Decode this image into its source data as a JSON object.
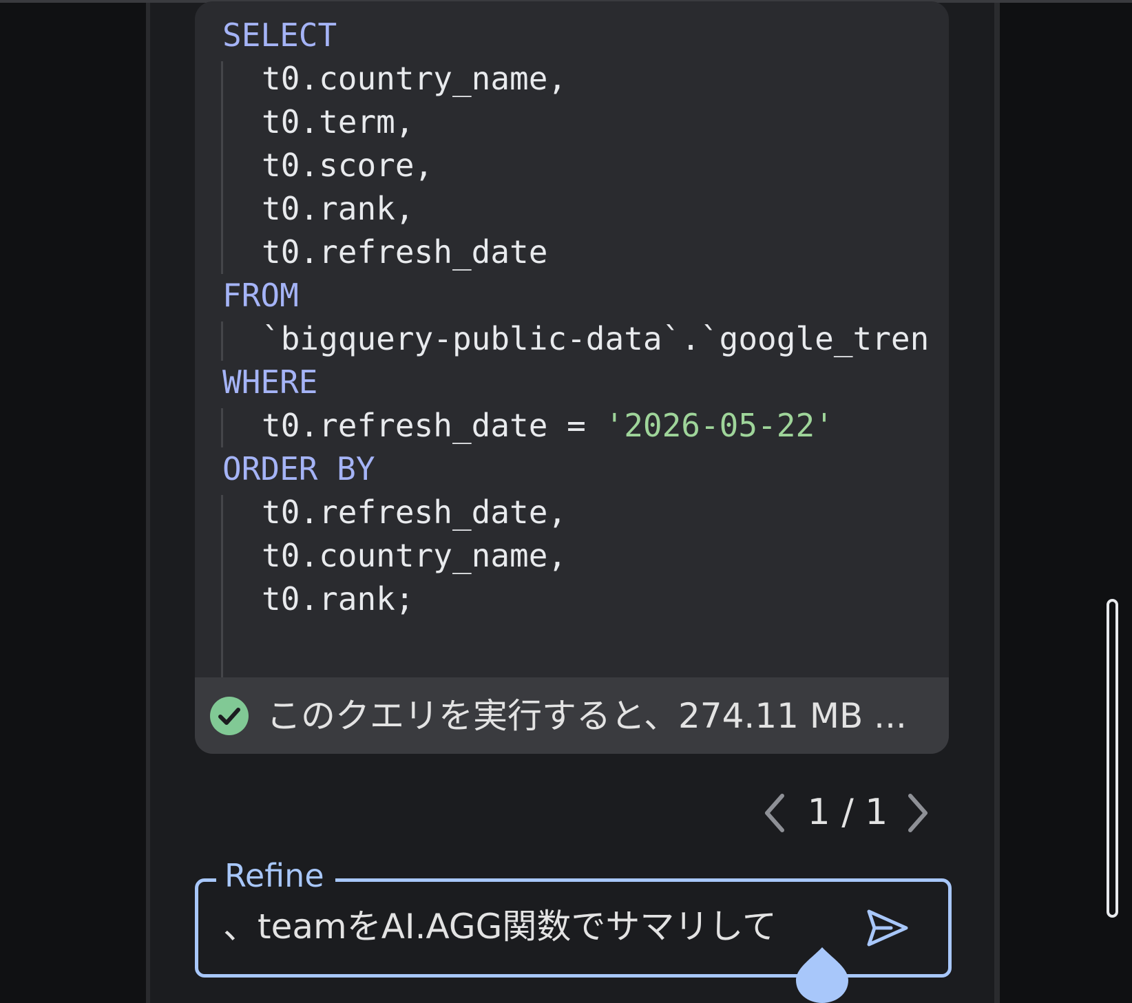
{
  "code": {
    "lines": [
      {
        "tokens": [
          {
            "text": "SELECT",
            "kind": "kw"
          }
        ],
        "indent": false
      },
      {
        "tokens": [
          {
            "text": "t0.country_name,",
            "kind": "plain"
          }
        ],
        "indent": true
      },
      {
        "tokens": [
          {
            "text": "t0.term,",
            "kind": "plain"
          }
        ],
        "indent": true
      },
      {
        "tokens": [
          {
            "text": "t0.score,",
            "kind": "plain"
          }
        ],
        "indent": true
      },
      {
        "tokens": [
          {
            "text": "t0.rank,",
            "kind": "plain"
          }
        ],
        "indent": true
      },
      {
        "tokens": [
          {
            "text": "t0.refresh_date",
            "kind": "plain"
          }
        ],
        "indent": true
      },
      {
        "tokens": [
          {
            "text": "FROM",
            "kind": "kw"
          }
        ],
        "indent": false
      },
      {
        "tokens": [
          {
            "text": "`bigquery-public-data`.`google_tren",
            "kind": "plain"
          }
        ],
        "indent": true
      },
      {
        "tokens": [
          {
            "text": "WHERE",
            "kind": "kw"
          }
        ],
        "indent": false
      },
      {
        "tokens": [
          {
            "text": "t0.refresh_date = ",
            "kind": "plain"
          },
          {
            "text": "'2026-05-22'",
            "kind": "str"
          }
        ],
        "indent": true
      },
      {
        "tokens": [
          {
            "text": "ORDER BY",
            "kind": "kw"
          }
        ],
        "indent": false
      },
      {
        "tokens": [
          {
            "text": "t0.refresh_date,",
            "kind": "plain"
          }
        ],
        "indent": true
      },
      {
        "tokens": [
          {
            "text": "t0.country_name,",
            "kind": "plain"
          }
        ],
        "indent": true
      },
      {
        "tokens": [
          {
            "text": "t0.rank;",
            "kind": "plain"
          }
        ],
        "indent": true
      }
    ]
  },
  "status": {
    "icon": "check-circle-icon",
    "text": "このクエリを実行すると、274.11 MB ...",
    "color": "#81c995"
  },
  "pager": {
    "count": "1 / 1",
    "prev_icon": "chevron-left-icon",
    "next_icon": "chevron-right-icon"
  },
  "refine": {
    "label": "Refine",
    "value": "、teamをAI.AGG関数でサマリして",
    "send_icon": "send-icon",
    "accent": "#a8c7fa"
  }
}
